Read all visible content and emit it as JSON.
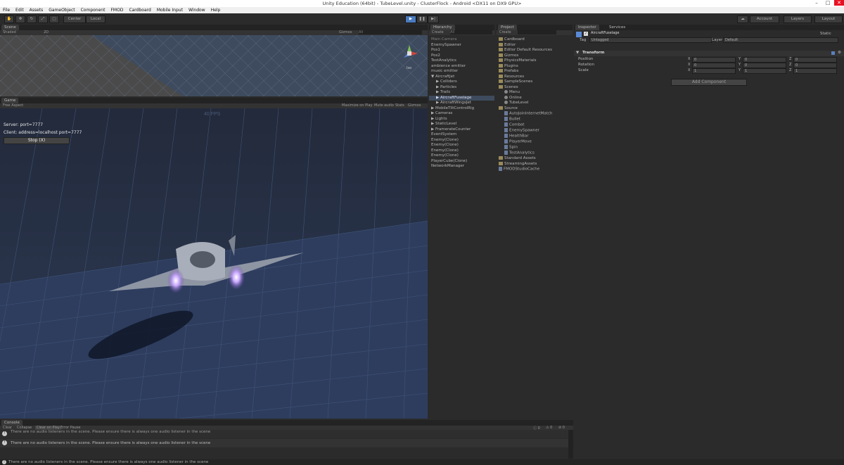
{
  "window_title": "Unity Education (64bit) - TubeLevel.unity - ClusterFlock - Android <DX11 on DX9 GPU>",
  "menu": [
    "File",
    "Edit",
    "Assets",
    "GameObject",
    "Component",
    "FMOD",
    "Cardboard",
    "Mobile Input",
    "Window",
    "Help"
  ],
  "toolbar": {
    "pivot": "Center",
    "space": "Local",
    "account": "Account",
    "layers": "Layers",
    "layout": "Layout"
  },
  "scene": {
    "tab": "Scene",
    "shading": "Shaded",
    "mode_2d": "2D",
    "gizmos": "Gizmos",
    "search": "All",
    "persp": "Iso"
  },
  "game": {
    "tab": "Game",
    "aspect": "Free Aspect",
    "maximize": "Maximize on Play",
    "mute": "Mute audio",
    "stats": "Stats",
    "gizmos": "Gizmos",
    "fps": "40 FPS",
    "server": "Server: port=7777",
    "client": "Client: address=localhost port=7777",
    "stop": "Stop (X)"
  },
  "hierarchy": {
    "tab": "Hierarchy",
    "create": "Create",
    "search": "All",
    "items": [
      {
        "label": "Main Camera",
        "indent": 0,
        "dim": true
      },
      {
        "label": "EnemySpawner",
        "indent": 0
      },
      {
        "label": "Pos1",
        "indent": 0
      },
      {
        "label": "Pos2",
        "indent": 0
      },
      {
        "label": "TestAnalytics",
        "indent": 0
      },
      {
        "label": "ambience emitter",
        "indent": 0
      },
      {
        "label": "music emitter",
        "indent": 0
      },
      {
        "label": "▼ AircraftJet",
        "indent": 0
      },
      {
        "label": "▶ Colliders",
        "indent": 1
      },
      {
        "label": "▶ Particles",
        "indent": 1
      },
      {
        "label": "▶ Trails",
        "indent": 1
      },
      {
        "label": "▶ AircraftFuselage",
        "indent": 1,
        "selected": true
      },
      {
        "label": "▶ AircraftWingsJet",
        "indent": 1
      },
      {
        "label": "▶ MobileTiltControlRig",
        "indent": 0
      },
      {
        "label": "▶ Cameras",
        "indent": 0
      },
      {
        "label": "▶ Lights",
        "indent": 0
      },
      {
        "label": "▶ StaticLevel",
        "indent": 0
      },
      {
        "label": "▶ FramerateCounter",
        "indent": 0
      },
      {
        "label": "EventSystem",
        "indent": 0
      },
      {
        "label": "Enemy(Clone)",
        "indent": 0
      },
      {
        "label": "Enemy(Clone)",
        "indent": 0
      },
      {
        "label": "Enemy(Clone)",
        "indent": 0
      },
      {
        "label": "Enemy(Clone)",
        "indent": 0
      },
      {
        "label": "PlayerCube(Clone)",
        "indent": 0
      },
      {
        "label": "NetworkManager",
        "indent": 0
      }
    ]
  },
  "project": {
    "tab": "Project",
    "create": "Create",
    "items": [
      {
        "label": "Cardboard",
        "type": "folder",
        "indent": 0
      },
      {
        "label": "Editor",
        "type": "folder",
        "indent": 0
      },
      {
        "label": "Editor Default Resources",
        "type": "folder",
        "indent": 0
      },
      {
        "label": "Gizmos",
        "type": "folder",
        "indent": 0
      },
      {
        "label": "PhysicsMaterials",
        "type": "folder",
        "indent": 0
      },
      {
        "label": "Plugins",
        "type": "folder",
        "indent": 0
      },
      {
        "label": "Prefabs",
        "type": "folder",
        "indent": 0
      },
      {
        "label": "Resources",
        "type": "folder",
        "indent": 0
      },
      {
        "label": "SampleScenes",
        "type": "folder",
        "indent": 0
      },
      {
        "label": "Scenes",
        "type": "folder",
        "indent": 0
      },
      {
        "label": "Menu",
        "type": "scene",
        "indent": 1
      },
      {
        "label": "Online",
        "type": "scene",
        "indent": 1
      },
      {
        "label": "TubeLevel",
        "type": "scene",
        "indent": 1
      },
      {
        "label": "Source",
        "type": "folder",
        "indent": 0
      },
      {
        "label": "AutoJoinInternetMatch",
        "type": "script",
        "indent": 1
      },
      {
        "label": "Bullet",
        "type": "script",
        "indent": 1
      },
      {
        "label": "Combat",
        "type": "script",
        "indent": 1
      },
      {
        "label": "EnemySpawner",
        "type": "script",
        "indent": 1
      },
      {
        "label": "HealthBar",
        "type": "script",
        "indent": 1
      },
      {
        "label": "PlayerMove",
        "type": "script",
        "indent": 1
      },
      {
        "label": "Spin",
        "type": "script",
        "indent": 1
      },
      {
        "label": "TestAnalytics",
        "type": "script",
        "indent": 1
      },
      {
        "label": "Standard Assets",
        "type": "folder",
        "indent": 0
      },
      {
        "label": "StreamingAssets",
        "type": "folder",
        "indent": 0
      },
      {
        "label": "FMODStudioCache",
        "type": "script",
        "indent": 0
      }
    ]
  },
  "inspector": {
    "tab": "Inspector",
    "services": "Services",
    "object_name": "AircraftFuselage",
    "static": "Static",
    "tag_label": "Tag",
    "tag": "Untagged",
    "layer_label": "Layer",
    "layer": "Default",
    "transform": "Transform",
    "rows": [
      {
        "label": "Position",
        "x": "0",
        "y": "0",
        "z": "0"
      },
      {
        "label": "Rotation",
        "x": "0",
        "y": "0",
        "z": "0"
      },
      {
        "label": "Scale",
        "x": "1",
        "y": "1",
        "z": "1"
      }
    ],
    "add_component": "Add Component"
  },
  "console": {
    "tab": "Console",
    "clear": "Clear",
    "collapse": "Collapse",
    "clear_on_play": "Clear on Play",
    "error_pause": "Error Pause",
    "msg_count": "0",
    "warn_count": "0",
    "err_count": "0",
    "messages": [
      "There are no audio listeners in the scene. Please ensure there is always one audio listener in the scene",
      "There are no audio listeners in the scene. Please ensure there is always one audio listener in the scene"
    ]
  },
  "status": "There are no audio listeners in the scene. Please ensure there is always one audio listener in the scene"
}
